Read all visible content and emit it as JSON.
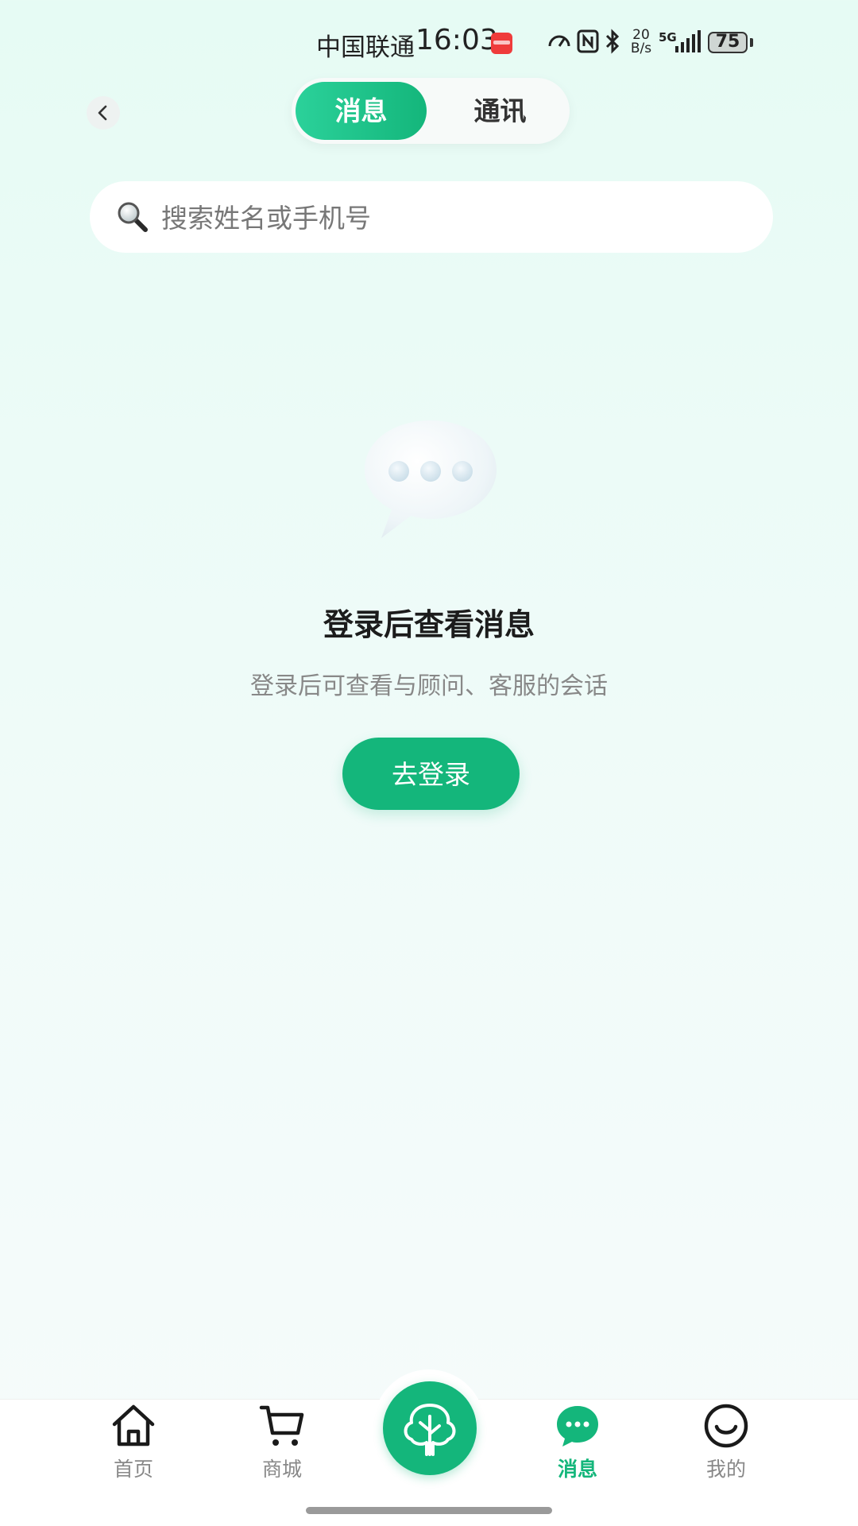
{
  "status_bar": {
    "carrier": "中国联通",
    "time": "16:03",
    "net_speed_top": "20",
    "net_speed_bottom": "B/s",
    "signal_label": "5G",
    "battery": "75"
  },
  "header": {
    "tabs": [
      {
        "label": "消息",
        "active": true
      },
      {
        "label": "通讯",
        "active": false
      }
    ]
  },
  "search": {
    "placeholder": "搜索姓名或手机号"
  },
  "empty_state": {
    "title": "登录后查看消息",
    "subtitle": "登录后可查看与顾问、客服的会话",
    "button_label": "去登录"
  },
  "bottom_nav": {
    "items": [
      {
        "label": "首页",
        "icon": "home-icon",
        "active": false
      },
      {
        "label": "商城",
        "icon": "cart-icon",
        "active": false
      },
      {
        "label": "",
        "icon": "tree-icon",
        "active": false
      },
      {
        "label": "消息",
        "icon": "message-icon",
        "active": true
      },
      {
        "label": "我的",
        "icon": "smile-icon",
        "active": false
      }
    ]
  },
  "colors": {
    "accent": "#14b67b",
    "accent_light": "#2bd19a",
    "background": "#e9fbf5"
  }
}
